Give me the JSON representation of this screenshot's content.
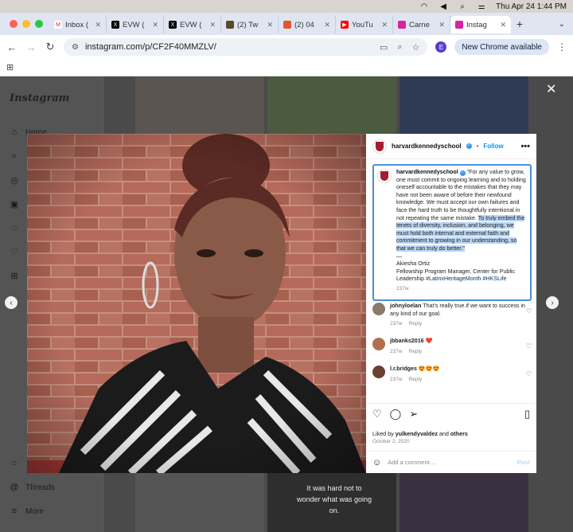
{
  "menubar": {
    "datetime": "Thu Apr 24  1:44 PM"
  },
  "tabs": [
    {
      "label": "Inbox (",
      "fav": "M",
      "color": "#ffffff",
      "fg": "#d93025"
    },
    {
      "label": "EVW (",
      "fav": "X",
      "color": "#000000",
      "fg": "#ffffff"
    },
    {
      "label": "EVW (",
      "fav": "X",
      "color": "#000000",
      "fg": "#ffffff"
    },
    {
      "label": "(2) Tw",
      "fav": "",
      "color": "#5a4a2a",
      "fg": "#ffffff"
    },
    {
      "label": "(2) 04",
      "fav": "",
      "color": "#e6552f",
      "fg": "#ffffff"
    },
    {
      "label": "YouTu",
      "fav": "▶",
      "color": "#ff0000",
      "fg": "#ffffff"
    },
    {
      "label": "Carne",
      "fav": "",
      "color": "#d6249f",
      "fg": "#ffffff"
    },
    {
      "label": "Instag",
      "fav": "",
      "color": "#d6249f",
      "fg": "#ffffff",
      "active": true
    }
  ],
  "toolbar": {
    "url": "instagram.com/p/CF2F40MMZLV/",
    "profile_initial": "E",
    "chrome_button": "New Chrome available"
  },
  "sidebar": {
    "logo": "Instagram",
    "home": "Home",
    "threads": "Threads",
    "more": "More"
  },
  "post": {
    "username": "harvardkennedyschool",
    "follow": "Follow",
    "caption_user": "harvardkennedyschool",
    "caption_plain": "\"For any value to grow, one must commit to ongoing learning and to holding oneself accountable to the mistakes that they may have not been aware of before their newfound knowledge. We must accept our own failures and face the hard truth to be thoughtfully intentional in not repeating the same mistake.",
    "caption_highlight": "To truly embed the tenets of diversity, inclusion, and belonging, we must hold both internal and external faith and commitment to growing in our understanding, so that we can truly do better.\"",
    "dash": "—",
    "author": "Akiesha Ortiz",
    "author_title": "Fellowship Program Manager, Center for Public Leadership",
    "hashtags": "#LatinxHeritageMonth #HKSLife",
    "caption_time": "237w",
    "comments": [
      {
        "user": "johnyloelan",
        "text": "That's really true.if we want to success in any kind of our goal.",
        "time": "237w",
        "reply": "Reply",
        "avatar": "#8a7a6a"
      },
      {
        "user": "jbbanks2016",
        "text": "❤️",
        "time": "237w",
        "reply": "Reply",
        "avatar": "#b07050"
      },
      {
        "user": "l.r.bridges",
        "text": "😍😍😍",
        "time": "237w",
        "reply": "Reply",
        "avatar": "#6a4030"
      }
    ],
    "liked_by_prefix": "Liked by ",
    "liked_by_user": "yulkendyvaldez",
    "liked_by_mid": " and ",
    "liked_by_others": "others",
    "date": "October 2, 2020",
    "add_comment": "Add a comment…",
    "post_label": "Post"
  },
  "background": {
    "overlay_text": "It was hard not to wonder what was going on."
  }
}
